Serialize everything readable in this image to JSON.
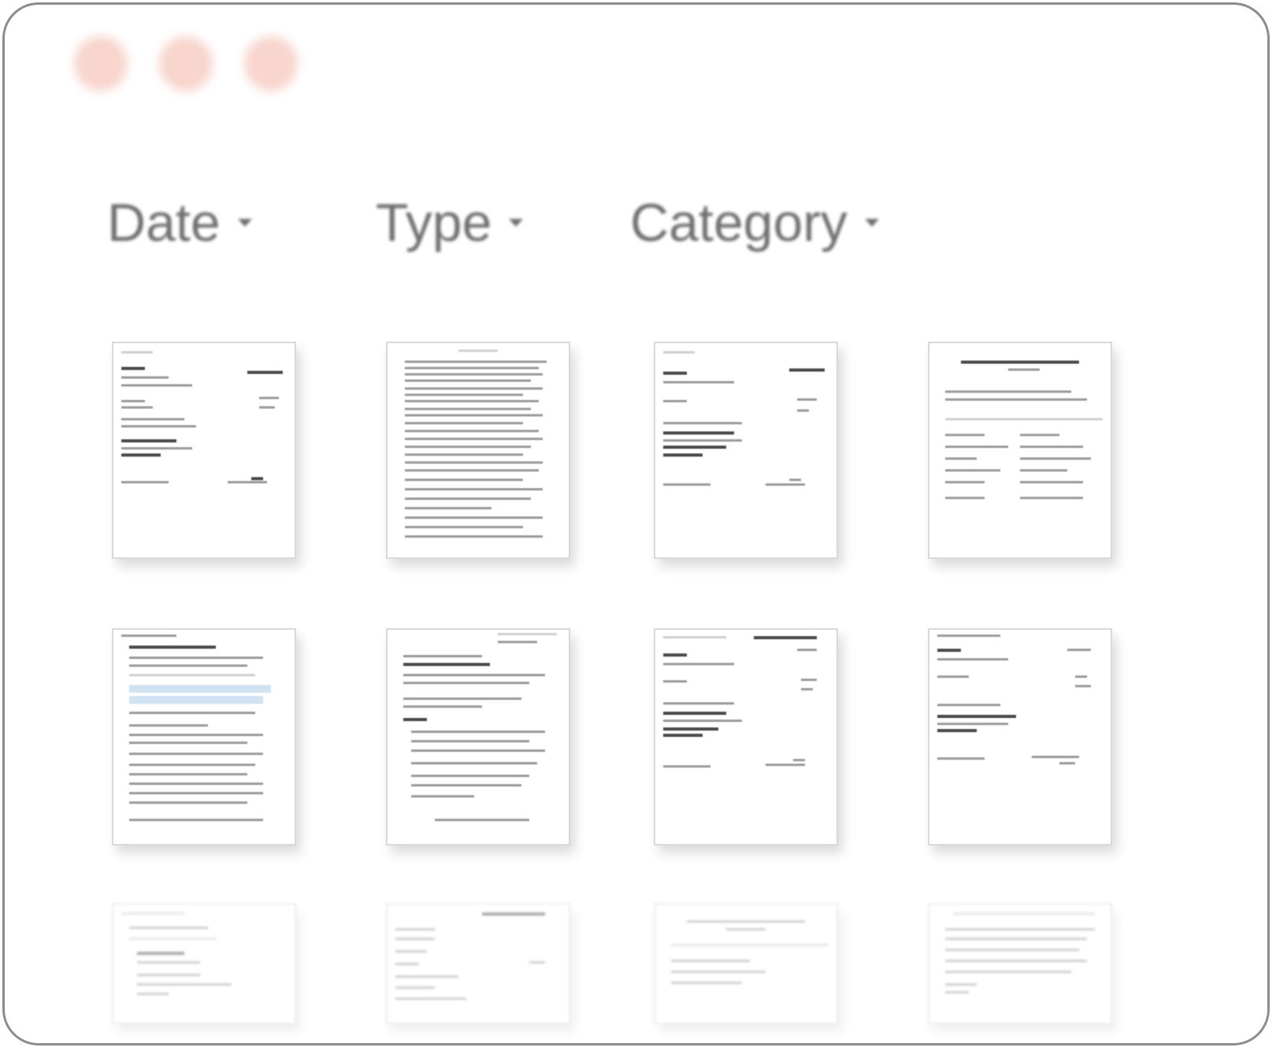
{
  "window": {
    "traffic_lights": [
      {
        "name": "close",
        "color": "#f2b3a6"
      },
      {
        "name": "minimize",
        "color": "#f2b3a6"
      },
      {
        "name": "zoom",
        "color": "#f2b3a6"
      }
    ]
  },
  "filters": [
    {
      "label": "Date",
      "icon": "chevron-down-icon"
    },
    {
      "label": "Type",
      "icon": "chevron-down-icon"
    },
    {
      "label": "Category",
      "icon": "chevron-down-icon"
    }
  ],
  "documents": {
    "rows": 3,
    "columns": 4,
    "icon": "document-thumbnail",
    "visible_rows_full": 2,
    "partially_visible_rows": 1
  }
}
